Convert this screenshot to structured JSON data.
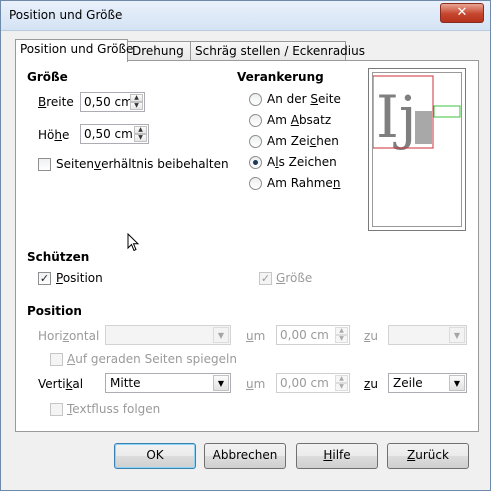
{
  "window": {
    "title": "Position und Größe"
  },
  "tabs": [
    {
      "label": "Position und Größe",
      "active": true
    },
    {
      "label": "Drehung",
      "active": false
    },
    {
      "label": "Schräg stellen / Eckenradius",
      "active": false
    }
  ],
  "size": {
    "heading": "Größe",
    "width_label": "Breite",
    "width_value": "0,50 cm",
    "height_label": "Höhe",
    "height_value": "0,50 cm",
    "keep_ratio_label": "Seitenverhältnis beibehalten",
    "keep_ratio_checked": false
  },
  "anchor": {
    "heading": "Verankerung",
    "options": [
      {
        "label": "An der Seite",
        "selected": false
      },
      {
        "label": "Am Absatz",
        "selected": false
      },
      {
        "label": "Am Zeichen",
        "selected": false
      },
      {
        "label": "Als Zeichen",
        "selected": true
      },
      {
        "label": "Am Rahmen",
        "selected": false
      }
    ]
  },
  "preview": {
    "glyphs": "Ij"
  },
  "protect": {
    "heading": "Schützen",
    "position_label": "Position",
    "position_checked": true,
    "size_label": "Größe",
    "size_checked": true
  },
  "position": {
    "heading": "Position",
    "horizontal_label": "Horizontal",
    "horizontal_value": "",
    "by_label": "um",
    "horizontal_by_value": "0,00 cm",
    "to_label": "zu",
    "horizontal_to_value": "",
    "mirror_label": "Auf geraden Seiten spiegeln",
    "vertical_label": "Vertikal",
    "vertical_value": "Mitte",
    "vertical_by_value": "0,00 cm",
    "vertical_to_value": "Zeile",
    "follow_text_label": "Textfluss folgen"
  },
  "buttons": {
    "ok": "OK",
    "cancel": "Abbrechen",
    "help": "Hilfe",
    "back": "Zurück"
  },
  "icons": {
    "close": "close-icon",
    "spin_up": "spin-up-icon",
    "spin_down": "spin-down-icon",
    "dropdown": "chevron-down-icon",
    "check": "checkmark-icon",
    "cursor": "mouse-pointer-icon"
  },
  "colors": {
    "accent": "#3c7fb1",
    "preview_frame": "#d0323a",
    "preview_bar": "#a8a8a8",
    "preview_target": "#3ec13e"
  }
}
